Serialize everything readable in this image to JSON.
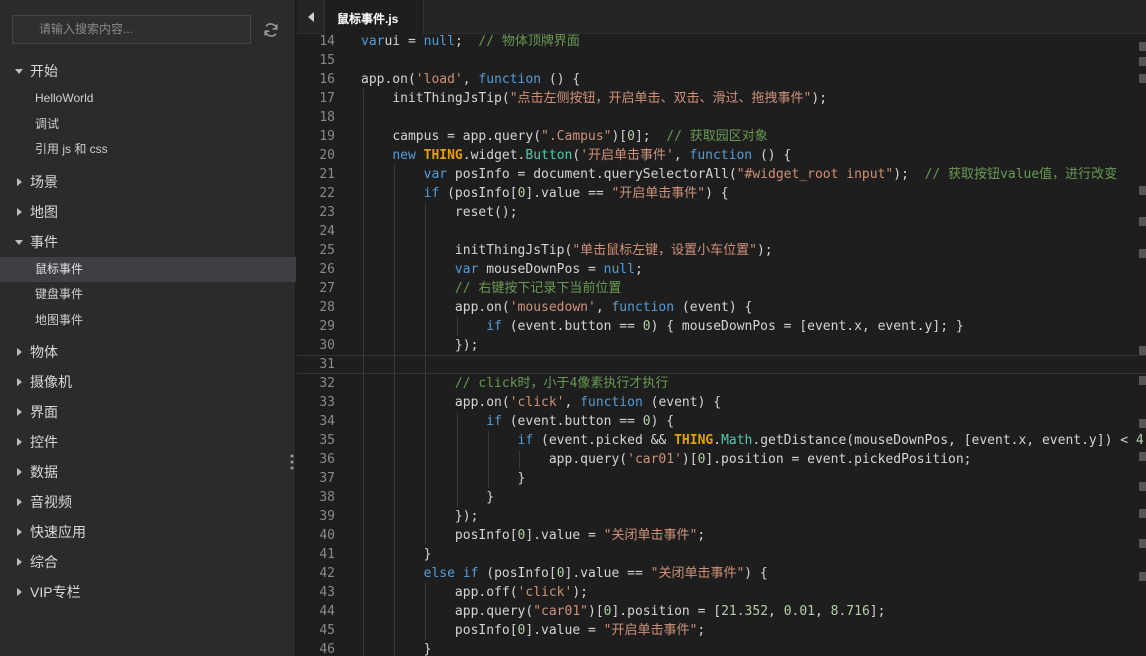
{
  "sidebar": {
    "search_placeholder": "请输入搜索内容...",
    "groups": [
      {
        "label": "开始",
        "expanded": true,
        "items": [
          "HelloWorld",
          "调试",
          "引用 js 和 css"
        ]
      },
      {
        "label": "场景",
        "expanded": false,
        "items": []
      },
      {
        "label": "地图",
        "expanded": false,
        "items": []
      },
      {
        "label": "事件",
        "expanded": true,
        "items": [
          "鼠标事件",
          "键盘事件",
          "地图事件"
        ]
      },
      {
        "label": "物体",
        "expanded": false,
        "items": []
      },
      {
        "label": "摄像机",
        "expanded": false,
        "items": []
      },
      {
        "label": "界面",
        "expanded": false,
        "items": []
      },
      {
        "label": "控件",
        "expanded": false,
        "items": []
      },
      {
        "label": "数据",
        "expanded": false,
        "items": []
      },
      {
        "label": "音视频",
        "expanded": false,
        "items": []
      },
      {
        "label": "快速应用",
        "expanded": false,
        "items": []
      },
      {
        "label": "综合",
        "expanded": false,
        "items": []
      },
      {
        "label": "VIP专栏",
        "expanded": false,
        "items": []
      }
    ],
    "active_item": "鼠标事件"
  },
  "editor": {
    "tab_label": "鼠标事件.js",
    "current_line": 31,
    "lines": [
      {
        "n": "14",
        "indent": 0,
        "tokens": [
          [
            "kw",
            "var"
          ],
          [
            "",
            "ui = "
          ],
          [
            "kw",
            "null"
          ],
          [
            "",
            ";  "
          ],
          [
            "cm",
            "// 物体顶牌界面"
          ]
        ]
      },
      {
        "n": "15",
        "indent": 0,
        "tokens": []
      },
      {
        "n": "16",
        "indent": 0,
        "tokens": [
          [
            "",
            "app.on("
          ],
          [
            "str",
            "'load'"
          ],
          [
            "",
            ", "
          ],
          [
            "kw",
            "function"
          ],
          [
            "",
            " () {"
          ]
        ]
      },
      {
        "n": "17",
        "indent": 1,
        "tokens": [
          [
            "",
            "initThingJsTip("
          ],
          [
            "str",
            "\"点击左侧按钮，开启单击、双击、滑过、拖拽事件\""
          ],
          [
            "",
            ");"
          ]
        ]
      },
      {
        "n": "18",
        "indent": 1,
        "tokens": []
      },
      {
        "n": "19",
        "indent": 1,
        "tokens": [
          [
            "",
            "campus = app.query("
          ],
          [
            "str",
            "\".Campus\""
          ],
          [
            "",
            ")["
          ],
          [
            "num",
            "0"
          ],
          [
            "",
            "];  "
          ],
          [
            "cm",
            "// 获取园区对象"
          ]
        ]
      },
      {
        "n": "20",
        "indent": 1,
        "tokens": [
          [
            "kw",
            "new "
          ],
          [
            "thing",
            "THING"
          ],
          [
            "",
            ".widget."
          ],
          [
            "cls",
            "Button"
          ],
          [
            "",
            "("
          ],
          [
            "str",
            "'开启单击事件'"
          ],
          [
            "",
            ", "
          ],
          [
            "kw",
            "function"
          ],
          [
            "",
            " () {"
          ]
        ]
      },
      {
        "n": "21",
        "indent": 2,
        "tokens": [
          [
            "kw",
            "var"
          ],
          [
            "",
            " posInfo = document.querySelectorAll("
          ],
          [
            "str",
            "\"#widget_root input\""
          ],
          [
            "",
            ");  "
          ],
          [
            "cm",
            "// 获取按钮value值，进行改变"
          ]
        ]
      },
      {
        "n": "22",
        "indent": 2,
        "tokens": [
          [
            "kw",
            "if"
          ],
          [
            "",
            " (posInfo["
          ],
          [
            "num",
            "0"
          ],
          [
            "",
            "].value == "
          ],
          [
            "str",
            "\"开启单击事件\""
          ],
          [
            "",
            ") {"
          ]
        ]
      },
      {
        "n": "23",
        "indent": 3,
        "tokens": [
          [
            "",
            "reset();"
          ]
        ]
      },
      {
        "n": "24",
        "indent": 3,
        "tokens": []
      },
      {
        "n": "25",
        "indent": 3,
        "tokens": [
          [
            "",
            "initThingJsTip("
          ],
          [
            "str",
            "\"单击鼠标左键，设置小车位置\""
          ],
          [
            "",
            ");"
          ]
        ]
      },
      {
        "n": "26",
        "indent": 3,
        "tokens": [
          [
            "kw",
            "var"
          ],
          [
            "",
            " mouseDownPos = "
          ],
          [
            "kw",
            "null"
          ],
          [
            "",
            ";"
          ]
        ]
      },
      {
        "n": "27",
        "indent": 3,
        "tokens": [
          [
            "cm",
            "// 右键按下记录下当前位置"
          ]
        ]
      },
      {
        "n": "28",
        "indent": 3,
        "tokens": [
          [
            "",
            "app.on("
          ],
          [
            "str",
            "'mousedown'"
          ],
          [
            "",
            ", "
          ],
          [
            "kw",
            "function"
          ],
          [
            "",
            " (event) {"
          ]
        ]
      },
      {
        "n": "29",
        "indent": 4,
        "tokens": [
          [
            "kw",
            "if"
          ],
          [
            "",
            " (event.button == "
          ],
          [
            "num",
            "0"
          ],
          [
            "",
            ") { mouseDownPos = [event.x, event.y]; }"
          ]
        ]
      },
      {
        "n": "30",
        "indent": 3,
        "tokens": [
          [
            "",
            "});"
          ]
        ]
      },
      {
        "n": "31",
        "indent": 3,
        "tokens": []
      },
      {
        "n": "32",
        "indent": 3,
        "tokens": [
          [
            "cm",
            "// click时，小于4像素执行才执行"
          ]
        ]
      },
      {
        "n": "33",
        "indent": 3,
        "tokens": [
          [
            "",
            "app.on("
          ],
          [
            "str",
            "'click'"
          ],
          [
            "",
            ", "
          ],
          [
            "kw",
            "function"
          ],
          [
            "",
            " (event) {"
          ]
        ]
      },
      {
        "n": "34",
        "indent": 4,
        "tokens": [
          [
            "kw",
            "if"
          ],
          [
            "",
            " (event.button == "
          ],
          [
            "num",
            "0"
          ],
          [
            "",
            ") {"
          ]
        ]
      },
      {
        "n": "35",
        "indent": 5,
        "tokens": [
          [
            "kw",
            "if"
          ],
          [
            "",
            " (event.picked && "
          ],
          [
            "thing",
            "THING"
          ],
          [
            "",
            "."
          ],
          [
            "cls",
            "Math"
          ],
          [
            "",
            ".getDistance(mouseDownPos, [event.x, event.y]) < "
          ],
          [
            "num",
            "4"
          ],
          [
            "",
            ")"
          ]
        ]
      },
      {
        "n": "36",
        "indent": 6,
        "tokens": [
          [
            "",
            "app.query("
          ],
          [
            "str",
            "'car01'"
          ],
          [
            "",
            ")["
          ],
          [
            "num",
            "0"
          ],
          [
            "",
            "].position = event.pickedPosition;"
          ]
        ]
      },
      {
        "n": "37",
        "indent": 5,
        "tokens": [
          [
            "",
            "}"
          ]
        ]
      },
      {
        "n": "38",
        "indent": 4,
        "tokens": [
          [
            "",
            "}"
          ]
        ]
      },
      {
        "n": "39",
        "indent": 3,
        "tokens": [
          [
            "",
            "});"
          ]
        ]
      },
      {
        "n": "40",
        "indent": 3,
        "tokens": [
          [
            "",
            "posInfo["
          ],
          [
            "num",
            "0"
          ],
          [
            "",
            "].value = "
          ],
          [
            "str",
            "\"关闭单击事件\""
          ],
          [
            "",
            ";"
          ]
        ]
      },
      {
        "n": "41",
        "indent": 2,
        "tokens": [
          [
            "",
            "}"
          ]
        ]
      },
      {
        "n": "42",
        "indent": 2,
        "tokens": [
          [
            "kw",
            "else if"
          ],
          [
            "",
            " (posInfo["
          ],
          [
            "num",
            "0"
          ],
          [
            "",
            "].value == "
          ],
          [
            "str",
            "\"关闭单击事件\""
          ],
          [
            "",
            ") {"
          ]
        ]
      },
      {
        "n": "43",
        "indent": 3,
        "tokens": [
          [
            "",
            "app.off("
          ],
          [
            "str",
            "'click'"
          ],
          [
            "",
            ");"
          ]
        ]
      },
      {
        "n": "44",
        "indent": 3,
        "tokens": [
          [
            "",
            "app.query("
          ],
          [
            "str",
            "\"car01\""
          ],
          [
            "",
            ")["
          ],
          [
            "num",
            "0"
          ],
          [
            "",
            "].position = ["
          ],
          [
            "num",
            "21.352"
          ],
          [
            "",
            ", "
          ],
          [
            "num",
            "0.01"
          ],
          [
            "",
            ", "
          ],
          [
            "num",
            "8.716"
          ],
          [
            "",
            "];"
          ]
        ]
      },
      {
        "n": "45",
        "indent": 3,
        "tokens": [
          [
            "",
            "posInfo["
          ],
          [
            "num",
            "0"
          ],
          [
            "",
            "].value = "
          ],
          [
            "str",
            "\"开启单击事件\""
          ],
          [
            "",
            ";"
          ]
        ]
      },
      {
        "n": "46",
        "indent": 2,
        "tokens": [
          [
            "",
            "}"
          ]
        ]
      }
    ]
  }
}
